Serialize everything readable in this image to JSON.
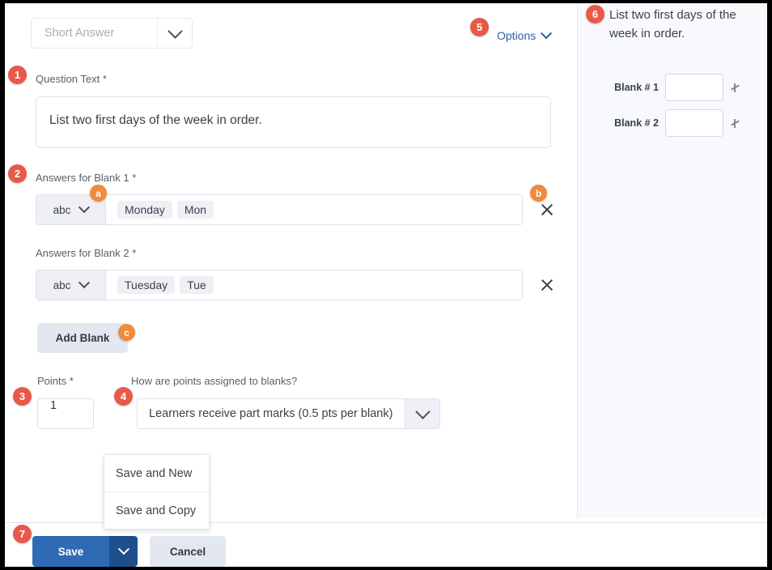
{
  "question_type": {
    "label": "Short Answer",
    "caret_icon": "chevron-down-icon"
  },
  "options_link": {
    "label": "Options",
    "caret_icon": "chevron-down-icon"
  },
  "question_text": {
    "label": "Question Text *",
    "value": "List two first days of the week in order."
  },
  "answers": [
    {
      "label": "Answers for Blank 1 *",
      "mode": "abc",
      "tags": [
        "Monday",
        "Mon"
      ],
      "delete_icon": "close-icon"
    },
    {
      "label": "Answers for Blank 2 *",
      "mode": "abc",
      "tags": [
        "Tuesday",
        "Tue"
      ],
      "delete_icon": "close-icon"
    }
  ],
  "add_blank": {
    "label": "Add Blank"
  },
  "points": {
    "label": "Points *",
    "value": "1"
  },
  "points_mode": {
    "label": "How are points assigned to blanks?",
    "value": "Learners receive part marks (0.5 pts per blank)",
    "caret_icon": "chevron-down-icon"
  },
  "save_menu": {
    "items": [
      {
        "label": "Save and New"
      },
      {
        "label": "Save and Copy"
      }
    ]
  },
  "footer": {
    "save_label": "Save",
    "save_caret_icon": "chevron-down-icon",
    "cancel_label": "Cancel"
  },
  "preview": {
    "question": "List two first days of the week in order.",
    "blanks": [
      {
        "label": "Blank # 1",
        "value": "",
        "grip_icon": "resize-grip-icon"
      },
      {
        "label": "Blank # 2",
        "value": "",
        "grip_icon": "resize-grip-icon"
      }
    ]
  },
  "callouts": [
    {
      "id": "1",
      "kind": "num"
    },
    {
      "id": "2",
      "kind": "num"
    },
    {
      "id": "3",
      "kind": "num"
    },
    {
      "id": "4",
      "kind": "num"
    },
    {
      "id": "5",
      "kind": "num"
    },
    {
      "id": "6",
      "kind": "num"
    },
    {
      "id": "7",
      "kind": "num"
    },
    {
      "id": "a",
      "kind": "alpha"
    },
    {
      "id": "b",
      "kind": "alpha"
    },
    {
      "id": "c",
      "kind": "alpha"
    }
  ],
  "colors": {
    "badge_number": "#e8594a",
    "badge_alpha": "#f08a3c",
    "accent_blue": "#2f6bb5",
    "link_blue": "#2b5fa8",
    "panel_bg": "#f8f9fc"
  }
}
